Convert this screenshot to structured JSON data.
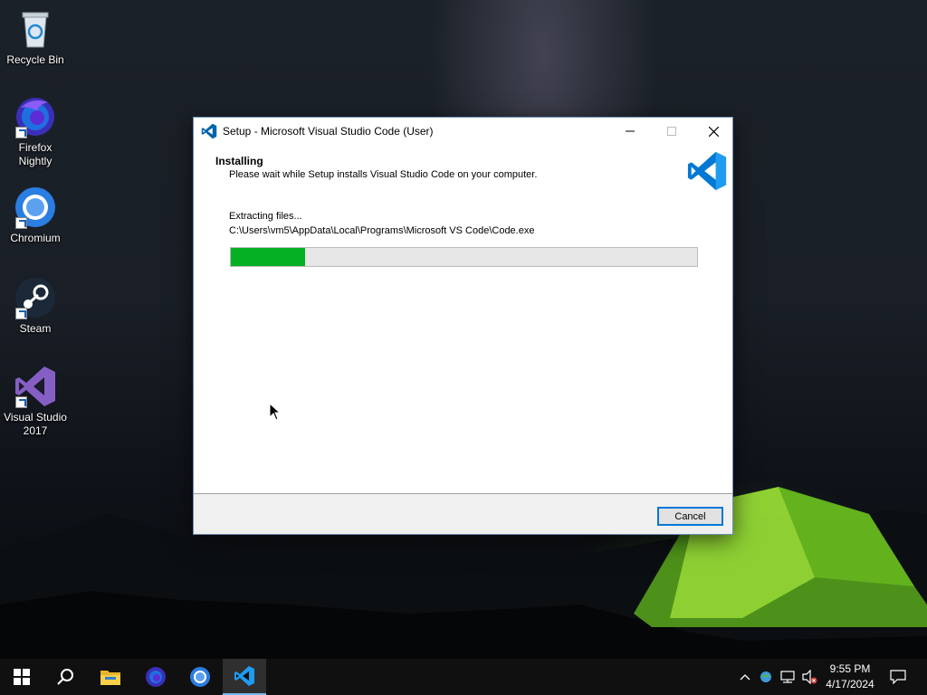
{
  "desktop": {
    "icons": [
      {
        "label": "Recycle Bin"
      },
      {
        "label": "Firefox Nightly"
      },
      {
        "label": "Chromium"
      },
      {
        "label": "Steam"
      },
      {
        "label": "Visual Studio 2017"
      }
    ]
  },
  "dialog": {
    "title": "Setup - Microsoft Visual Studio Code (User)",
    "heading": "Installing",
    "subheading": "Please wait while Setup installs Visual Studio Code on your computer.",
    "status": "Extracting files...",
    "current_file": "C:\\Users\\vm5\\AppData\\Local\\Programs\\Microsoft VS Code\\Code.exe",
    "progress_fraction": 0.16,
    "cancel_label": "Cancel",
    "accent_color": "#06b025"
  },
  "taskbar": {
    "items": [
      "start-icon",
      "search-icon",
      "file-explorer-icon",
      "firefox-nightly-icon",
      "chromium-icon",
      "vscode-setup-icon"
    ],
    "active_item": "vscode-setup-icon",
    "clock": {
      "time": "9:55 PM",
      "date": "4/17/2024"
    }
  },
  "colors": {
    "dialog_border": "#6f8fb5",
    "vscode_blue": "#0065a9",
    "taskbar": "#101010"
  }
}
